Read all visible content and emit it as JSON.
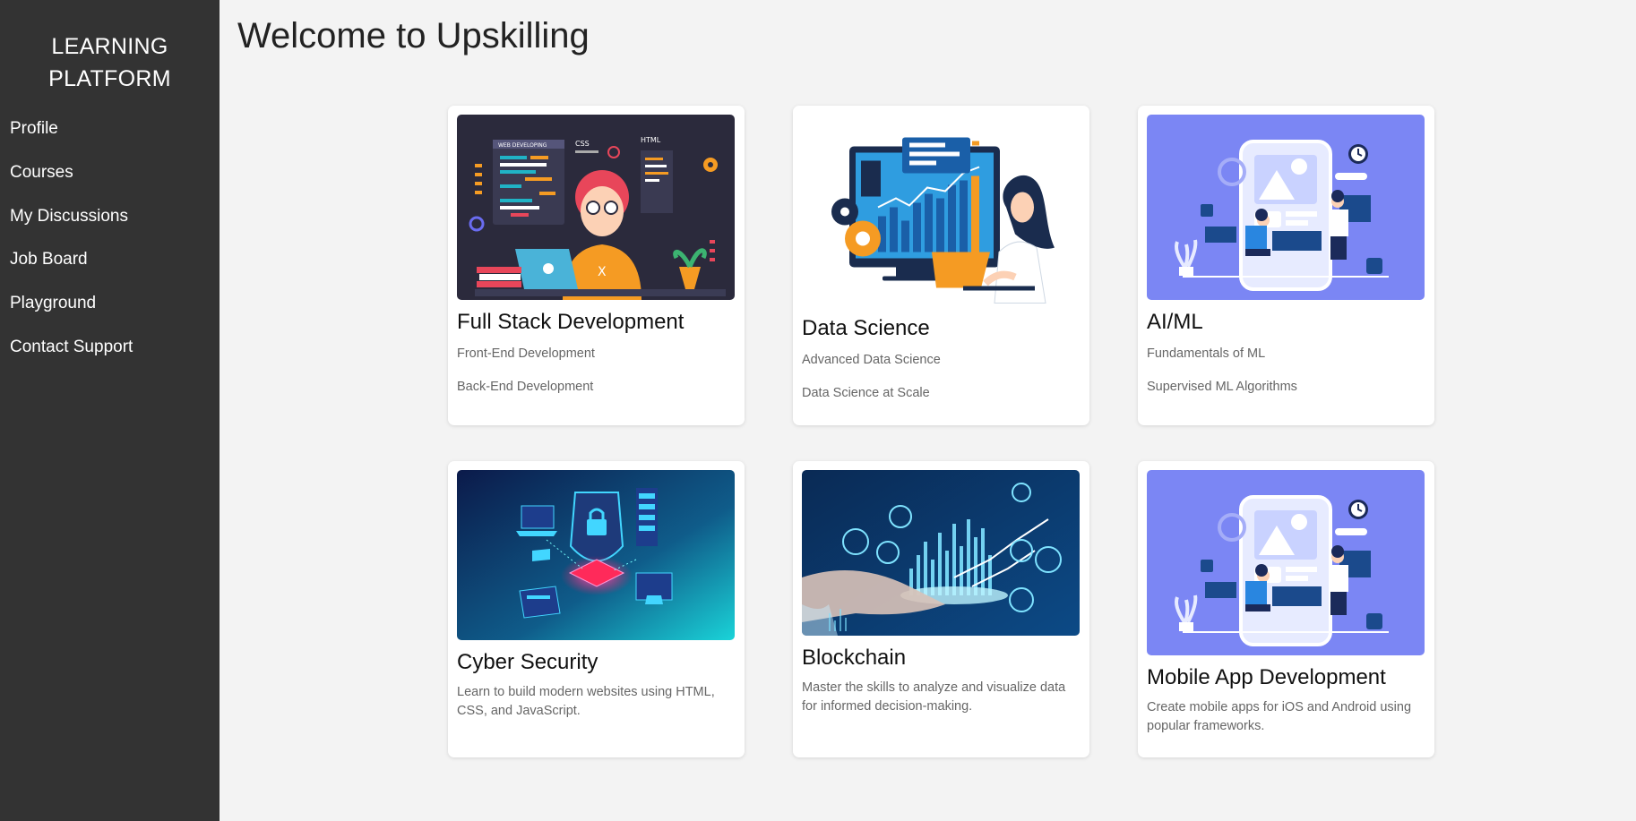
{
  "sidebar": {
    "brand": "LEARNING PLATFORM",
    "items": [
      {
        "label": "Profile"
      },
      {
        "label": "Courses"
      },
      {
        "label": "My Discussions"
      },
      {
        "label": "Job Board"
      },
      {
        "label": "Playground"
      },
      {
        "label": "Contact Support"
      }
    ]
  },
  "main": {
    "title": "Welcome to Upskilling",
    "cards": [
      {
        "title": "Full Stack Development",
        "items": [
          "Front-End Development",
          "Back-End Development"
        ]
      },
      {
        "title": "Data Science",
        "items": [
          "Advanced Data Science",
          "Data Science at Scale"
        ]
      },
      {
        "title": "AI/ML",
        "items": [
          "Fundamentals of ML",
          "Supervised ML Algorithms"
        ]
      },
      {
        "title": "Cyber Security",
        "description": "Learn to build modern websites using HTML, CSS, and JavaScript."
      },
      {
        "title": "Blockchain",
        "description": "Master the skills to analyze and visualize data for informed decision-making."
      },
      {
        "title": "Mobile App Development",
        "description": "Create mobile apps for iOS and Android using popular frameworks."
      }
    ]
  },
  "illustration_texts": {
    "web_dev_panel": "WEB DEVELOPING",
    "css_tag": "CSS",
    "html_tag": "HTML",
    "x_mark": "X"
  },
  "colors": {
    "sidebar_bg": "#333333",
    "page_bg": "#f3f3f3",
    "card_bg": "#ffffff",
    "ml_illustration_bg": "#7b86f4",
    "fullstack_illustration_bg": "#2b2a3c"
  }
}
